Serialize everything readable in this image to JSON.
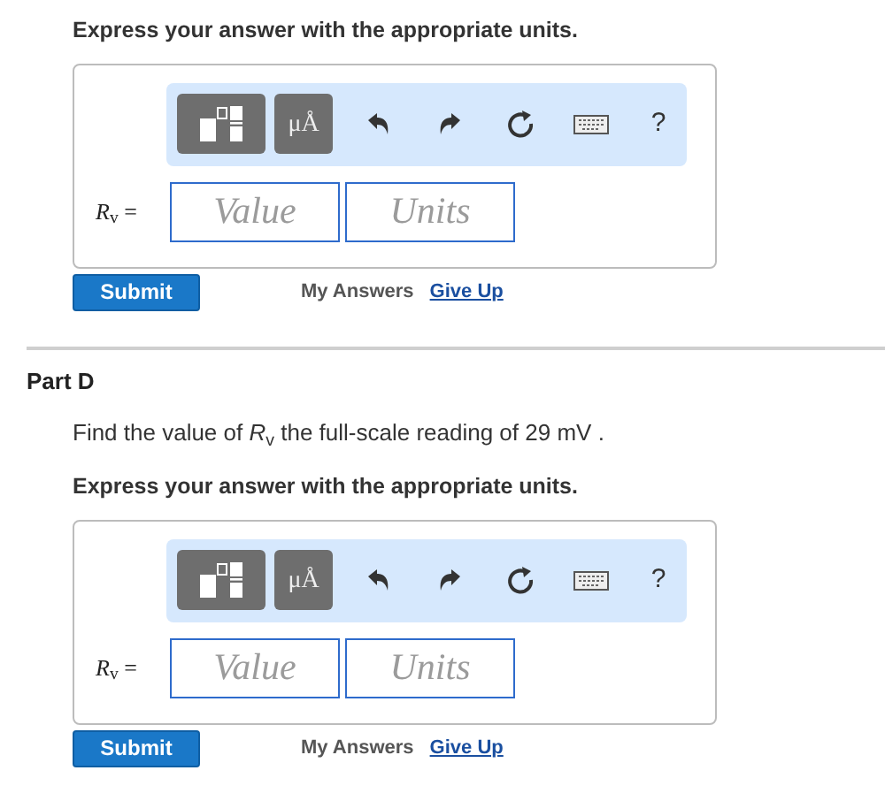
{
  "parts": [
    {
      "instruction": "Express your answer with the appropriate units.",
      "toolbar": {
        "units_button": "μÅ",
        "help_button": "?"
      },
      "label": "*R*$_{v}$ =",
      "value_placeholder": "Value",
      "units_placeholder": "Units",
      "submit": "Submit",
      "my_answers": "My Answers",
      "give_up": "Give Up"
    },
    {
      "heading": "Part D",
      "prompt": "Find the value of *R*$_{v}$ the full-scale reading of 29 mV .",
      "instruction": "Express your answer with the appropriate units.",
      "toolbar": {
        "units_button": "μÅ",
        "help_button": "?"
      },
      "label": "*R*$_{v}$ =",
      "value_placeholder": "Value",
      "units_placeholder": "Units",
      "submit": "Submit",
      "my_answers": "My Answers",
      "give_up": "Give Up"
    }
  ]
}
